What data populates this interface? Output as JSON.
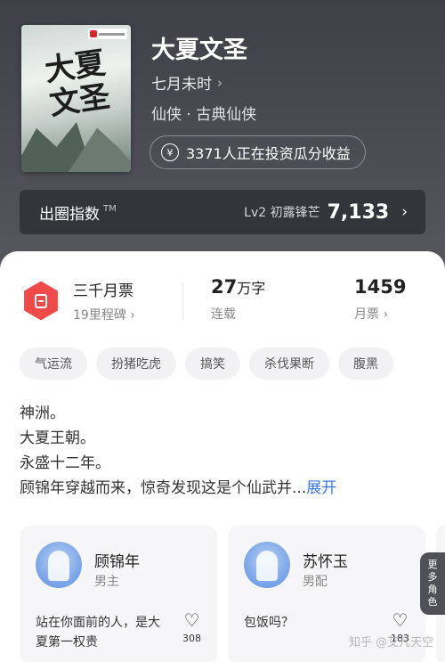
{
  "book": {
    "title": "大夏文圣",
    "author": "七月未时",
    "genre": "仙侠 · 古典仙侠",
    "cover_title": "大夏文圣",
    "invest_text": "3371人正在投资瓜分收益"
  },
  "index_bar": {
    "label": "出圈指数",
    "tm": "TM",
    "level": "Lv2 初露锋芒",
    "value": "7,133"
  },
  "stats": {
    "ticket_title": "三千月票",
    "ticket_sub": "19里程碑",
    "words_value": "27",
    "words_unit": "万字",
    "words_sub": "连载",
    "votes_value": "1459",
    "votes_sub": "月票"
  },
  "tags": [
    "气运流",
    "扮猪吃虎",
    "搞笑",
    "杀伐果断",
    "腹黑"
  ],
  "synopsis": {
    "lines": [
      "神洲。",
      "大夏王朝。",
      "永盛十二年。",
      "顾锦年穿越而来，惊奇发现这是个仙武并..."
    ],
    "expand": "展开"
  },
  "characters": [
    {
      "name": "顾锦年",
      "role": "男主",
      "quote": "站在你面前的人，是大夏第一权贵",
      "likes": "308"
    },
    {
      "name": "苏怀玉",
      "role": "男配",
      "quote": "包饭吗？",
      "likes": "183"
    }
  ],
  "more_roles": [
    "更",
    "多",
    "角",
    "色"
  ],
  "watermark": "知乎 @艾凡天空",
  "icons": {
    "chevron": "›",
    "heart": "♡",
    "yen": "¥"
  }
}
